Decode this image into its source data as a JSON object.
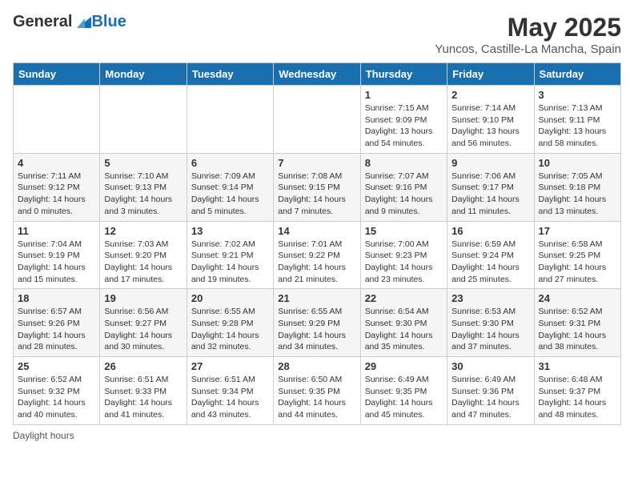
{
  "header": {
    "logo_general": "General",
    "logo_blue": "Blue",
    "month_title": "May 2025",
    "location": "Yuncos, Castille-La Mancha, Spain"
  },
  "days_of_week": [
    "Sunday",
    "Monday",
    "Tuesday",
    "Wednesday",
    "Thursday",
    "Friday",
    "Saturday"
  ],
  "weeks": [
    [
      {
        "day": "",
        "info": ""
      },
      {
        "day": "",
        "info": ""
      },
      {
        "day": "",
        "info": ""
      },
      {
        "day": "",
        "info": ""
      },
      {
        "day": "1",
        "info": "Sunrise: 7:15 AM\nSunset: 9:09 PM\nDaylight: 13 hours\nand 54 minutes."
      },
      {
        "day": "2",
        "info": "Sunrise: 7:14 AM\nSunset: 9:10 PM\nDaylight: 13 hours\nand 56 minutes."
      },
      {
        "day": "3",
        "info": "Sunrise: 7:13 AM\nSunset: 9:11 PM\nDaylight: 13 hours\nand 58 minutes."
      }
    ],
    [
      {
        "day": "4",
        "info": "Sunrise: 7:11 AM\nSunset: 9:12 PM\nDaylight: 14 hours\nand 0 minutes."
      },
      {
        "day": "5",
        "info": "Sunrise: 7:10 AM\nSunset: 9:13 PM\nDaylight: 14 hours\nand 3 minutes."
      },
      {
        "day": "6",
        "info": "Sunrise: 7:09 AM\nSunset: 9:14 PM\nDaylight: 14 hours\nand 5 minutes."
      },
      {
        "day": "7",
        "info": "Sunrise: 7:08 AM\nSunset: 9:15 PM\nDaylight: 14 hours\nand 7 minutes."
      },
      {
        "day": "8",
        "info": "Sunrise: 7:07 AM\nSunset: 9:16 PM\nDaylight: 14 hours\nand 9 minutes."
      },
      {
        "day": "9",
        "info": "Sunrise: 7:06 AM\nSunset: 9:17 PM\nDaylight: 14 hours\nand 11 minutes."
      },
      {
        "day": "10",
        "info": "Sunrise: 7:05 AM\nSunset: 9:18 PM\nDaylight: 14 hours\nand 13 minutes."
      }
    ],
    [
      {
        "day": "11",
        "info": "Sunrise: 7:04 AM\nSunset: 9:19 PM\nDaylight: 14 hours\nand 15 minutes."
      },
      {
        "day": "12",
        "info": "Sunrise: 7:03 AM\nSunset: 9:20 PM\nDaylight: 14 hours\nand 17 minutes."
      },
      {
        "day": "13",
        "info": "Sunrise: 7:02 AM\nSunset: 9:21 PM\nDaylight: 14 hours\nand 19 minutes."
      },
      {
        "day": "14",
        "info": "Sunrise: 7:01 AM\nSunset: 9:22 PM\nDaylight: 14 hours\nand 21 minutes."
      },
      {
        "day": "15",
        "info": "Sunrise: 7:00 AM\nSunset: 9:23 PM\nDaylight: 14 hours\nand 23 minutes."
      },
      {
        "day": "16",
        "info": "Sunrise: 6:59 AM\nSunset: 9:24 PM\nDaylight: 14 hours\nand 25 minutes."
      },
      {
        "day": "17",
        "info": "Sunrise: 6:58 AM\nSunset: 9:25 PM\nDaylight: 14 hours\nand 27 minutes."
      }
    ],
    [
      {
        "day": "18",
        "info": "Sunrise: 6:57 AM\nSunset: 9:26 PM\nDaylight: 14 hours\nand 28 minutes."
      },
      {
        "day": "19",
        "info": "Sunrise: 6:56 AM\nSunset: 9:27 PM\nDaylight: 14 hours\nand 30 minutes."
      },
      {
        "day": "20",
        "info": "Sunrise: 6:55 AM\nSunset: 9:28 PM\nDaylight: 14 hours\nand 32 minutes."
      },
      {
        "day": "21",
        "info": "Sunrise: 6:55 AM\nSunset: 9:29 PM\nDaylight: 14 hours\nand 34 minutes."
      },
      {
        "day": "22",
        "info": "Sunrise: 6:54 AM\nSunset: 9:30 PM\nDaylight: 14 hours\nand 35 minutes."
      },
      {
        "day": "23",
        "info": "Sunrise: 6:53 AM\nSunset: 9:30 PM\nDaylight: 14 hours\nand 37 minutes."
      },
      {
        "day": "24",
        "info": "Sunrise: 6:52 AM\nSunset: 9:31 PM\nDaylight: 14 hours\nand 38 minutes."
      }
    ],
    [
      {
        "day": "25",
        "info": "Sunrise: 6:52 AM\nSunset: 9:32 PM\nDaylight: 14 hours\nand 40 minutes."
      },
      {
        "day": "26",
        "info": "Sunrise: 6:51 AM\nSunset: 9:33 PM\nDaylight: 14 hours\nand 41 minutes."
      },
      {
        "day": "27",
        "info": "Sunrise: 6:51 AM\nSunset: 9:34 PM\nDaylight: 14 hours\nand 43 minutes."
      },
      {
        "day": "28",
        "info": "Sunrise: 6:50 AM\nSunset: 9:35 PM\nDaylight: 14 hours\nand 44 minutes."
      },
      {
        "day": "29",
        "info": "Sunrise: 6:49 AM\nSunset: 9:35 PM\nDaylight: 14 hours\nand 45 minutes."
      },
      {
        "day": "30",
        "info": "Sunrise: 6:49 AM\nSunset: 9:36 PM\nDaylight: 14 hours\nand 47 minutes."
      },
      {
        "day": "31",
        "info": "Sunrise: 6:48 AM\nSunset: 9:37 PM\nDaylight: 14 hours\nand 48 minutes."
      }
    ]
  ],
  "footer": {
    "note": "Daylight hours"
  }
}
